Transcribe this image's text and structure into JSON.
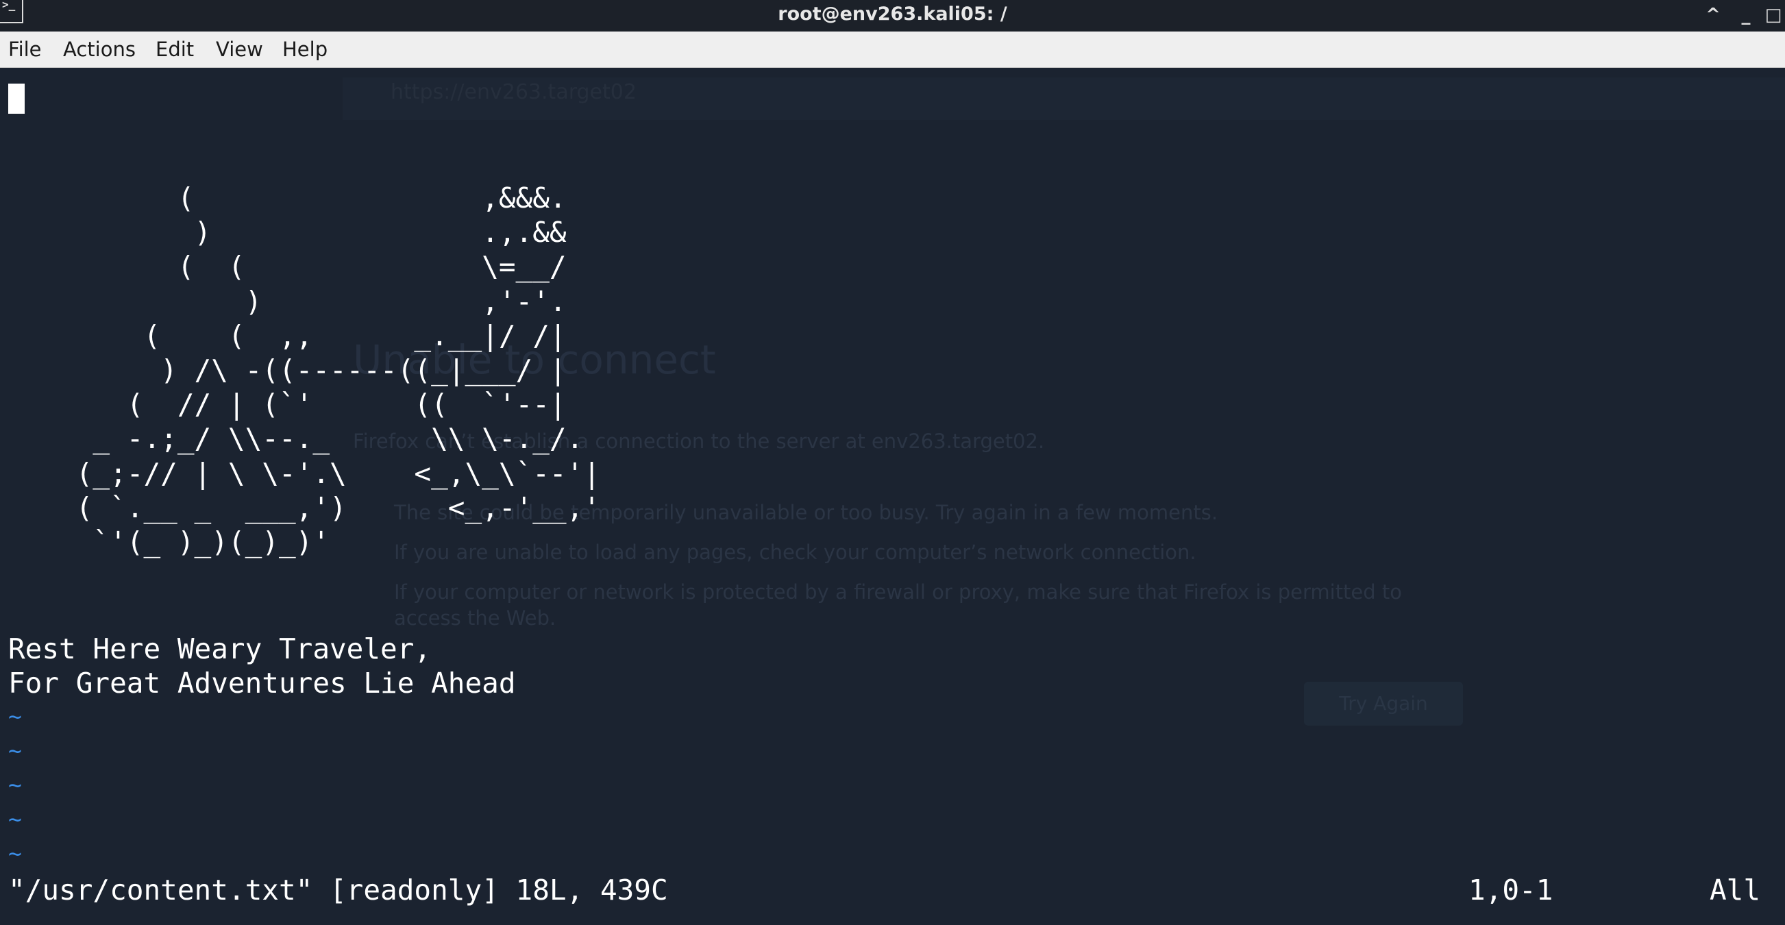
{
  "window": {
    "title": "root@env263.kali05: /",
    "icon": "terminal-icon",
    "controls": {
      "minimize_up_glyph": "^",
      "minimize_glyph": "_",
      "maximize_glyph": "□"
    }
  },
  "menubar": {
    "items": [
      "File",
      "Actions",
      "Edit",
      "View",
      "Help"
    ]
  },
  "background_ghost": {
    "url": "https://env263.target02",
    "heading": "Unable to connect",
    "lead": "Firefox can’t establish a connection to the server at env263.target02.",
    "bullets": [
      "The site could be temporarily unavailable or too busy. Try again in a few moments.",
      "If you are unable to load any pages, check your computer’s network connection.",
      "If your computer or network is protected by a firewall or proxy, make sure that Firefox is permitted to access the Web."
    ],
    "button": "Try Again"
  },
  "editor": {
    "ascii_art": "          (                 ,&&&.\n           )                .,.&&\n          (  (              \\=__/\n              )             ,'-'.\n        (    (  ,,      _.__|/ /|\n         ) /\\ -((------((_|___/ |\n       (  // | (`'      ((  `'--|\n     _ -.;_/ \\\\--._      \\\\ \\-._/.\n    (_;-// | \\ \\-'.\\    <_,\\_\\`--'|\n    ( `.__ _  ___,')      <_,-'__,'\n     `'(_ )_)(_)_)'",
    "message_line1": "Rest Here Weary Traveler,",
    "message_line2": "For Great Adventures Lie Ahead",
    "tilde": "~",
    "status_file": "\"/usr/content.txt\" [readonly] 18L, 439C",
    "status_position": "1,0-1",
    "status_scroll": "All"
  },
  "colors": {
    "terminal_bg": "#1b2330",
    "text": "#ffffff",
    "tilde": "#3b8ee8",
    "menubar_bg": "#efefef",
    "titlebar_bg": "#1c2129"
  }
}
